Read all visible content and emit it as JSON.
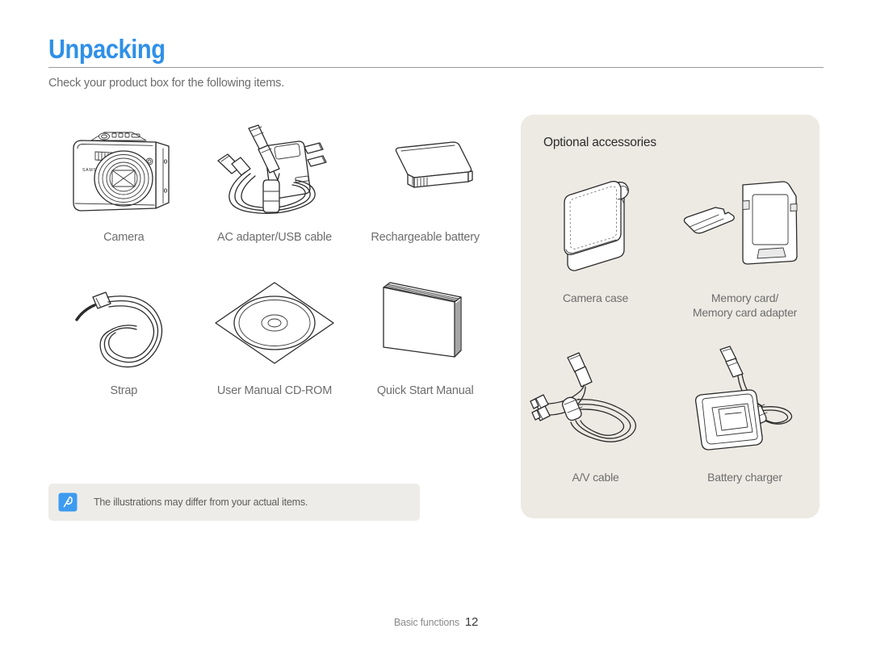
{
  "header": {
    "title": "Unpacking",
    "title_color": "#2f90e8",
    "subtitle": "Check your product box for the following items."
  },
  "included_items": [
    {
      "label": "Camera",
      "icon": "camera-icon"
    },
    {
      "label": "AC adapter/USB cable",
      "icon": "ac-adapter-usb-cable-icon"
    },
    {
      "label": "Rechargeable battery",
      "icon": "rechargeable-battery-icon"
    },
    {
      "label": "Strap",
      "icon": "strap-icon"
    },
    {
      "label": "User Manual CD-ROM",
      "icon": "cd-rom-icon"
    },
    {
      "label": "Quick Start Manual",
      "icon": "quick-start-manual-icon"
    }
  ],
  "optional_panel": {
    "title": "Optional accessories",
    "background_color": "#edeae3",
    "items": [
      {
        "label": "Camera case",
        "icon": "camera-case-icon"
      },
      {
        "label": "Memory card/\nMemory card adapter",
        "label_line1": "Memory card/",
        "label_line2": "Memory card adapter",
        "icon": "memory-card-icon"
      },
      {
        "label": "A/V cable",
        "icon": "av-cable-icon"
      },
      {
        "label": "Battery charger",
        "icon": "battery-charger-icon"
      }
    ]
  },
  "note": {
    "icon": "note-pen-icon",
    "icon_color": "#3d9bf0",
    "text": "The illustrations may differ from your actual items.",
    "background_color": "#eeece8"
  },
  "footer": {
    "section": "Basic functions",
    "page_number": "12"
  },
  "branding": {
    "camera_brand": "SAMSUNG"
  }
}
